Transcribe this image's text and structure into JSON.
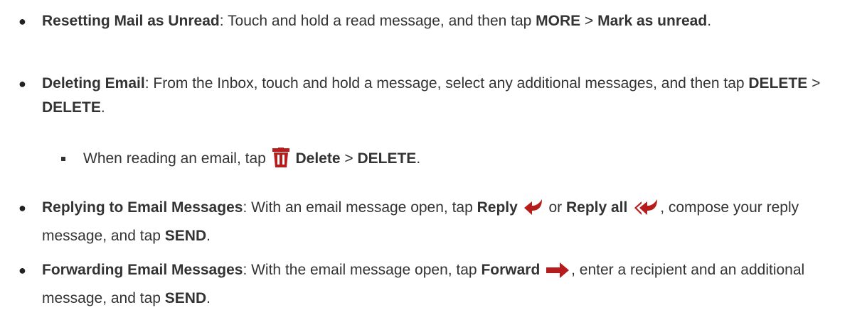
{
  "items": [
    {
      "title": "Resetting Mail as Unread",
      "text_1": ": Touch and hold a read message, and then tap ",
      "more": "MORE",
      "sep": " > ",
      "mark_as_unread": "Mark as unread",
      "end": "."
    },
    {
      "title": "Deleting Email",
      "text_1": ": From the Inbox, touch and hold a message, select any additional messages, and then tap ",
      "delete_1": "DELETE",
      "sep": " > ",
      "delete_2": "DELETE",
      "end": "."
    },
    {
      "text_1": "When reading an email, tap ",
      "delete_label": "Delete",
      "sep": " > ",
      "delete_caps": "DELETE",
      "end": "."
    },
    {
      "title": "Replying to Email Messages",
      "text_1": ": With an email message open, tap ",
      "reply": "Reply",
      "or": " or ",
      "reply_all": "Reply all",
      "text_2": ", compose your reply message, and tap ",
      "send": "SEND",
      "end": "."
    },
    {
      "title": "Forwarding Email Messages",
      "text_1": ": With the email message open, tap ",
      "forward": "Forward",
      "text_2": ", enter a recipient and an additional message, and tap ",
      "send": "SEND",
      "end": "."
    }
  ],
  "colors": {
    "text": "#333333",
    "icon_red": "#b71c1c"
  },
  "icons": [
    "trash-icon",
    "reply-icon",
    "reply-all-icon",
    "forward-icon"
  ]
}
